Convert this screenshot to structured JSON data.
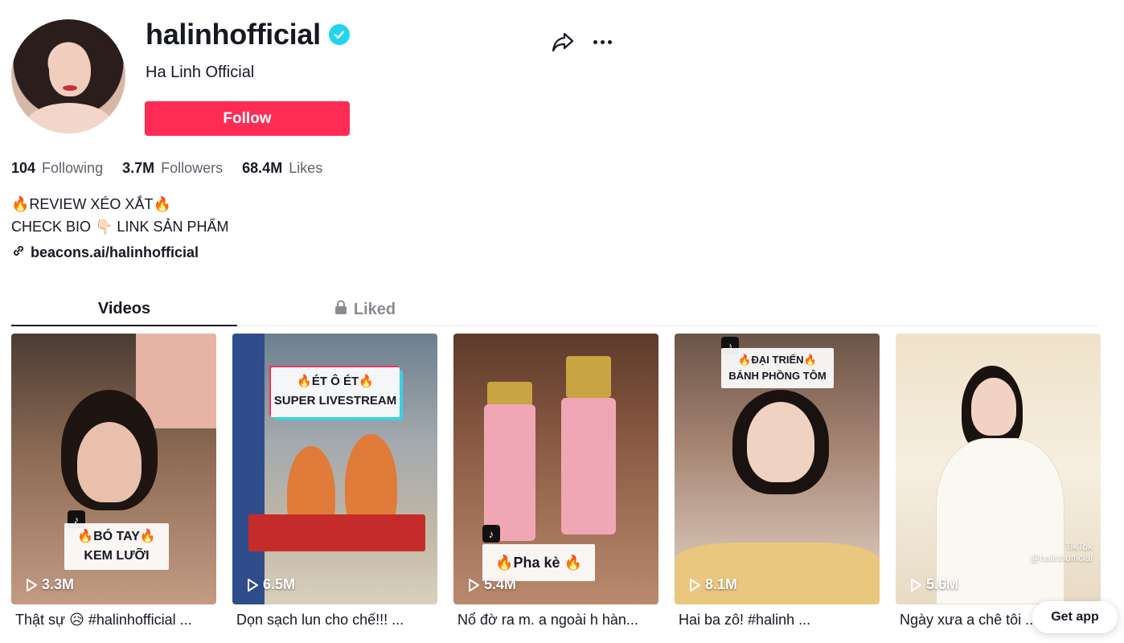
{
  "profile": {
    "username": "halinhofficial",
    "display_name": "Ha Linh Official",
    "follow_label": "Follow",
    "verified": true
  },
  "stats": {
    "following_count": "104",
    "following_label": "Following",
    "followers_count": "3.7M",
    "followers_label": "Followers",
    "likes_count": "68.4M",
    "likes_label": "Likes"
  },
  "bio": {
    "line1": "🔥REVIEW XÉO XẮT🔥",
    "line2": "CHECK BIO 👇🏻 LINK SẢN PHẨM",
    "link": "beacons.ai/halinhofficial"
  },
  "tabs": {
    "videos": "Videos",
    "liked": "Liked"
  },
  "videos": [
    {
      "views": "3.3M",
      "overlay_line1": "🔥BÓ TAY🔥",
      "overlay_line2": "KEM LƯỠI",
      "caption": "Thật sự 😥 #halinhofficial ..."
    },
    {
      "views": "6.5M",
      "overlay_line1": "🔥ÉT Ô ÉT🔥",
      "overlay_line2": "SUPER LIVESTREAM",
      "caption": "Dọn sạch lun cho chế!!! ..."
    },
    {
      "views": "5.4M",
      "overlay_line1": "🔥Pha kè 🔥",
      "overlay_line2": "",
      "caption": "Nổ đờ ra m. a ngoài h hàn..."
    },
    {
      "views": "8.1M",
      "overlay_line1": "🔥ĐẠI TRIỂN🔥",
      "overlay_line2": "BÁNH PHỒNG TÔM",
      "caption": "Hai ba zô! #halinh ..."
    },
    {
      "views": "5.6M",
      "overlay_line1": "TikTok",
      "overlay_line2": "@halinhofficial",
      "caption": "Ngày xưa a chê tôi ..."
    }
  ],
  "get_app_label": "Get app",
  "colors": {
    "accent": "#fe2c55",
    "verified": "#20d5ec",
    "text": "#161823",
    "muted": "#60626a"
  },
  "icons": [
    "verified-badge-icon",
    "share-icon",
    "more-icon",
    "link-icon",
    "lock-icon",
    "play-icon",
    "tiktok-logo-icon"
  ]
}
